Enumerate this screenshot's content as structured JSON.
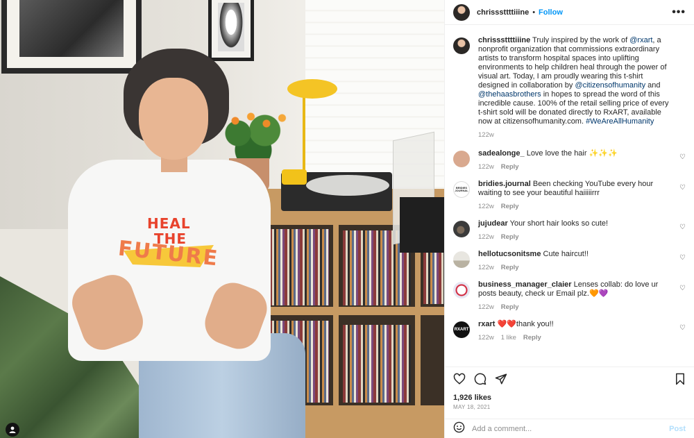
{
  "post": {
    "author": "chrisssttttiiine",
    "follow_label": "Follow",
    "separator": "•",
    "more_label": "•••"
  },
  "caption": {
    "username": "chrisssttttiiine",
    "text_1": " Truly inspired by the work of ",
    "mention_1": "@rxart",
    "text_2": ", a nonprofit organization that commissions extraordinary artists to transform hospital spaces into uplifting environments to help children heal through the power of visual art. Today, I am proudly wearing this t-shirt designed in collaboration by ",
    "mention_2": "@citizensofhumanity",
    "text_3": " and ",
    "mention_3": "@thehaasbrothers",
    "text_4": " in hopes to spread the word of this incredible cause. 100% of the retail selling price of every t-shirt sold will be donated directly to RxART, available now at citizensofhumanity.com. ",
    "hashtag": "#WeAreAllHumanity",
    "time": "122w"
  },
  "comments": [
    {
      "username": "sadealonge_",
      "text": " Love love the hair ✨✨✨",
      "time": "122w",
      "likes": "",
      "reply": "Reply",
      "avatar_color": "#d9a98f"
    },
    {
      "username": "bridies.journal",
      "text": " Been checking YouTube every hour waiting to see your beautiful haiiiiirrr",
      "time": "122w",
      "likes": "",
      "reply": "Reply",
      "avatar_color": "#ffffff",
      "avatar_text": "BRIDIES JOURNAL"
    },
    {
      "username": "jujudear",
      "text": " Your short hair looks so cute!",
      "time": "122w",
      "likes": "",
      "reply": "Reply",
      "avatar_color": "#3b3b3b"
    },
    {
      "username": "hellotucsonitsme",
      "text": " Cute haircut!!",
      "time": "122w",
      "likes": "",
      "reply": "Reply",
      "avatar_color": "#c9c4b8"
    },
    {
      "username": "business_manager_claier",
      "text": " Lenses collab: do love ur posts beauty, check ur Email plz.🧡💜",
      "time": "122w",
      "likes": "",
      "reply": "Reply",
      "avatar_color": "#e6e6f2"
    },
    {
      "username": "rxart",
      "text": " ❤️❤️thank you!!",
      "time": "122w",
      "likes": "1 like",
      "reply": "Reply",
      "avatar_color": "#111111",
      "avatar_text": "RXART"
    }
  ],
  "actions": {
    "like_icon": "heart-icon",
    "comment_icon": "comment-icon",
    "share_icon": "paper-plane-icon",
    "save_icon": "bookmark-icon"
  },
  "likes": "1,926 likes",
  "date": "MAY 18, 2021",
  "add_comment": {
    "placeholder": "Add a comment...",
    "post_label": "Post"
  },
  "photo": {
    "shirt_line_1": "HEAL",
    "shirt_line_2": "THE",
    "shirt_line_3": "FUTURE"
  },
  "colors": {
    "link": "#0095f6",
    "mention": "#00376b",
    "muted": "#8e8e8e",
    "post_disabled": "#b2dffc"
  }
}
